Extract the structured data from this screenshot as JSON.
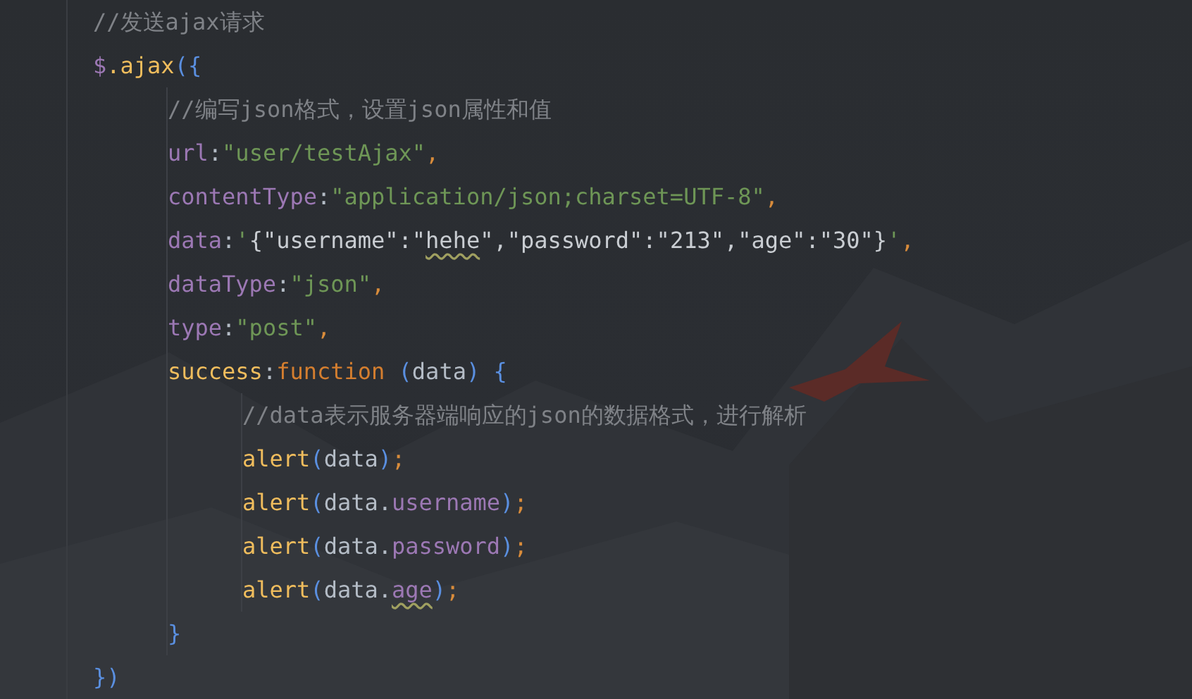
{
  "code_lines": [
    {
      "tokens": [
        {
          "kind": "comment",
          "text": "//发送ajax请求"
        }
      ]
    },
    {
      "tokens": [
        {
          "kind": "property",
          "text": "$"
        },
        {
          "kind": "function",
          "text": ".ajax"
        },
        {
          "kind": "bracket",
          "text": "({"
        }
      ],
      "children": [
        {
          "tokens": [
            {
              "kind": "comment",
              "text": "//编写json格式，设置json属性和值"
            }
          ]
        },
        {
          "tokens": [
            {
              "kind": "property",
              "text": "url"
            },
            {
              "kind": "plain",
              "text": ":"
            },
            {
              "kind": "string",
              "text": "\"user/testAjax\""
            },
            {
              "kind": "punct",
              "text": ","
            }
          ]
        },
        {
          "tokens": [
            {
              "kind": "property",
              "text": "contentType"
            },
            {
              "kind": "plain",
              "text": ":"
            },
            {
              "kind": "string",
              "text": "\"application/json;charset=UTF-8\""
            },
            {
              "kind": "punct",
              "text": ","
            }
          ]
        },
        {
          "tokens": [
            {
              "kind": "property",
              "text": "data"
            },
            {
              "kind": "plain",
              "text": ":"
            },
            {
              "kind": "string",
              "text": "'"
            },
            {
              "kind": "json",
              "text": "{\"username\":\""
            },
            {
              "kind": "json",
              "text": "hehe",
              "typo": true
            },
            {
              "kind": "json",
              "text": "\",\"password\":\"213\",\"age\":\"30\"}"
            },
            {
              "kind": "string",
              "text": "'"
            },
            {
              "kind": "punct",
              "text": ","
            }
          ]
        },
        {
          "tokens": [
            {
              "kind": "property",
              "text": "dataType"
            },
            {
              "kind": "plain",
              "text": ":"
            },
            {
              "kind": "string",
              "text": "\"json\""
            },
            {
              "kind": "punct",
              "text": ","
            }
          ]
        },
        {
          "tokens": [
            {
              "kind": "property",
              "text": "type"
            },
            {
              "kind": "plain",
              "text": ":"
            },
            {
              "kind": "string",
              "text": "\"post\""
            },
            {
              "kind": "punct",
              "text": ","
            }
          ]
        },
        {
          "tokens": [
            {
              "kind": "function",
              "text": "success"
            },
            {
              "kind": "plain",
              "text": ":"
            },
            {
              "kind": "keyword",
              "text": "function "
            },
            {
              "kind": "bracket",
              "text": "("
            },
            {
              "kind": "plain",
              "text": "data"
            },
            {
              "kind": "bracket",
              "text": ")"
            },
            {
              "kind": "bracket",
              "text": " {"
            }
          ],
          "children": [
            {
              "tokens": [
                {
                  "kind": "comment",
                  "text": "//data表示服务器端响应的json的数据格式，进行解析"
                }
              ]
            },
            {
              "tokens": [
                {
                  "kind": "function",
                  "text": "alert"
                },
                {
                  "kind": "bracket",
                  "text": "("
                },
                {
                  "kind": "plain",
                  "text": "data"
                },
                {
                  "kind": "bracket",
                  "text": ")"
                },
                {
                  "kind": "punct",
                  "text": ";"
                }
              ]
            },
            {
              "tokens": [
                {
                  "kind": "function",
                  "text": "alert"
                },
                {
                  "kind": "bracket",
                  "text": "("
                },
                {
                  "kind": "plain",
                  "text": "data."
                },
                {
                  "kind": "property",
                  "text": "username"
                },
                {
                  "kind": "bracket",
                  "text": ")"
                },
                {
                  "kind": "punct",
                  "text": ";"
                }
              ]
            },
            {
              "tokens": [
                {
                  "kind": "function",
                  "text": "alert"
                },
                {
                  "kind": "bracket",
                  "text": "("
                },
                {
                  "kind": "plain",
                  "text": "data."
                },
                {
                  "kind": "property",
                  "text": "password"
                },
                {
                  "kind": "bracket",
                  "text": ")"
                },
                {
                  "kind": "punct",
                  "text": ";"
                }
              ]
            },
            {
              "tokens": [
                {
                  "kind": "function",
                  "text": "alert"
                },
                {
                  "kind": "bracket",
                  "text": "("
                },
                {
                  "kind": "plain",
                  "text": "data."
                },
                {
                  "kind": "property",
                  "text": "age",
                  "typo": true
                },
                {
                  "kind": "bracket",
                  "text": ")"
                },
                {
                  "kind": "punct",
                  "text": ";"
                }
              ]
            }
          ]
        },
        {
          "tokens": [
            {
              "kind": "bracket",
              "text": "}"
            }
          ]
        }
      ]
    },
    {
      "tokens": [
        {
          "kind": "bracket",
          "text": "})"
        }
      ]
    }
  ]
}
